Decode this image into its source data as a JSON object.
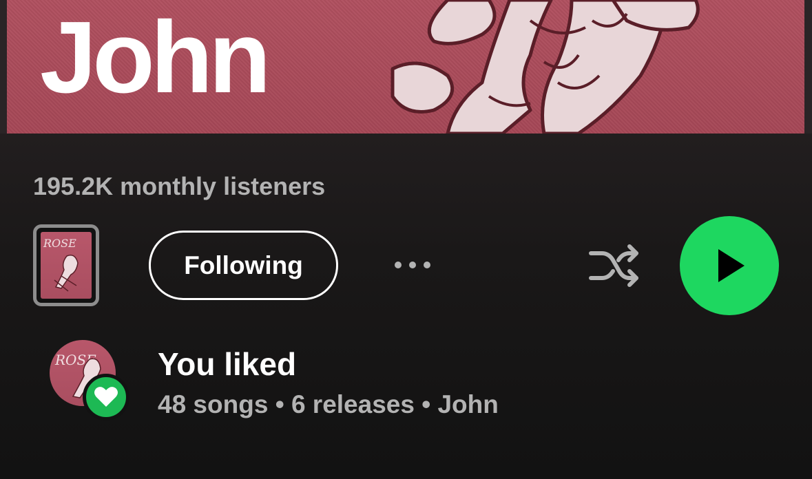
{
  "artist": {
    "name": "John",
    "monthly_listeners": "195.2K monthly listeners",
    "cover_text": "ROSE"
  },
  "actions": {
    "follow_label": "Following",
    "more_icon": "more-horizontal-icon",
    "shuffle_icon": "shuffle-icon",
    "play_icon": "play-icon"
  },
  "liked": {
    "title": "You liked",
    "songs": "48 songs",
    "releases": "6 releases",
    "artist": "John",
    "separator": "•",
    "badge_icon": "heart-icon"
  },
  "colors": {
    "accent": "#1ed760",
    "background": "#121212",
    "secondary_text": "#b3b3b3",
    "banner": "#aa4a59"
  }
}
